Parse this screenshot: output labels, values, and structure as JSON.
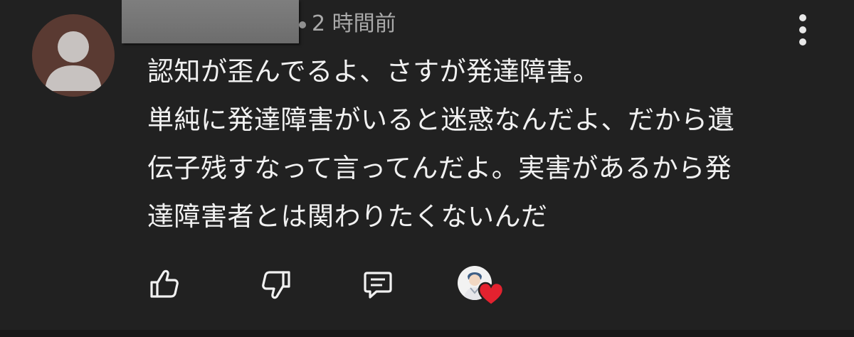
{
  "comment": {
    "timestamp": "2 時間前",
    "text_lines": [
      "認知が歪んでるよ、さすが発達障害。",
      "単純に発達障害がいると迷惑なんだよ、だから遺",
      "伝子残すなって言ってんだよ。実害があるから発",
      "達障害者とは関わりたくないんだ"
    ],
    "author_redacted": true,
    "creator_heart": true
  },
  "icons": {
    "avatar": "default-person-icon",
    "menu": "more-vertical-icon",
    "like": "thumbs-up-icon",
    "dislike": "thumbs-down-icon",
    "reply": "reply-comment-icon",
    "heart": "heart-icon"
  },
  "colors": {
    "background": "#212121",
    "text_primary": "#f1f1f1",
    "text_secondary": "#aaaaaa",
    "avatar_bg": "#5a3a32",
    "heart": "#e3222f"
  }
}
